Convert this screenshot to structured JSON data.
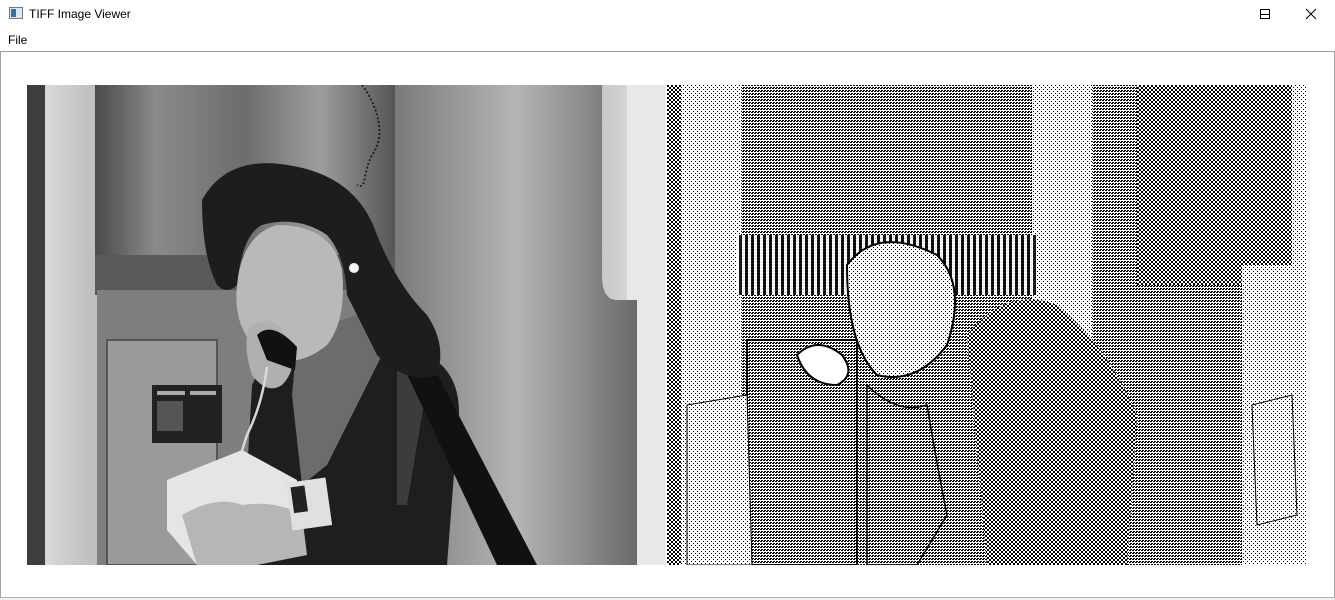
{
  "window": {
    "title": "TIFF Image Viewer",
    "controls": {
      "minimize": "minimize",
      "maximize": "maximize",
      "close": "close"
    }
  },
  "menu": {
    "items": [
      {
        "label": "File"
      }
    ]
  },
  "images": {
    "left": {
      "kind": "grayscale photograph"
    },
    "right": {
      "kind": "dithered halftone"
    }
  },
  "colors": {
    "title_bar": "#ffffff",
    "frame_border": "#a0a0a0",
    "text": "#000000"
  }
}
